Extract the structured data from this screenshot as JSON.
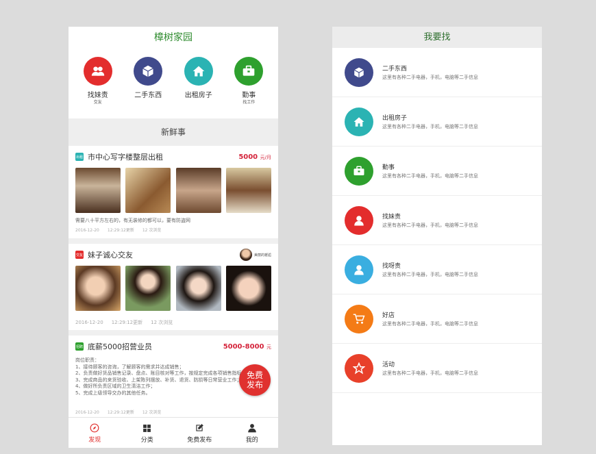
{
  "left": {
    "title": "樟树家园",
    "categories": [
      {
        "label": "找妹责",
        "sub": "交友",
        "icon": "people-icon",
        "color": "#e32d2d"
      },
      {
        "label": "二手东西",
        "sub": "",
        "icon": "box-icon",
        "color": "#404a8c"
      },
      {
        "label": "出租房子",
        "sub": "",
        "icon": "house-icon",
        "color": "#2bb3b3"
      },
      {
        "label": "勤事",
        "sub": "找工作",
        "icon": "briefcase-icon",
        "color": "#2ea02e"
      }
    ],
    "section_title": "新鲜事",
    "post1": {
      "tag": "出租",
      "tag_color": "#2bb3b3",
      "title": "市中心写字楼整层出租",
      "price": "5000",
      "price_unit": "元/月",
      "desc": "需要八十平方左右的，有无装修的都可以，要有防盗网",
      "date": "2016-12-20",
      "updated": "12:29:12更新",
      "views": "12 次浏览"
    },
    "post2": {
      "tag": "交友",
      "tag_color": "#e32d2d",
      "title": "妹子诚心交友",
      "user": "美丽的邂逅",
      "date": "2016-12-20",
      "updated": "12:29:12更新",
      "views": "12 次浏览"
    },
    "post3": {
      "tag": "招聘",
      "tag_color": "#2ea02e",
      "title": "底薪5000招营业员",
      "price": "5000-8000",
      "price_unit": "元",
      "body": [
        "岗位职责：",
        "1、接待顾客的咨询，了解顾客的需求并达成销售；",
        "2、负责做好货品销售记录、盘点、账目核对等工作，按规定完成各项销售指标；",
        "3、完成商品的来货验收、上架陈列摆放、补货、退货、防损等日常营业工作；",
        "4、做好所负责区域的卫生清洁工作；",
        "5、完成上级领导交办的其他任务。"
      ],
      "date": "2016-12-20",
      "updated": "12:29:12更新",
      "views": "12 次浏览"
    },
    "fab": "免费发布",
    "tabs": [
      {
        "label": "发现",
        "icon": "compass-icon"
      },
      {
        "label": "分类",
        "icon": "grid-icon"
      },
      {
        "label": "免费发布",
        "icon": "edit-icon"
      },
      {
        "label": "我的",
        "icon": "user-icon"
      }
    ]
  },
  "right": {
    "title": "我要找",
    "items": [
      {
        "name": "二手东西",
        "desc": "这里有各种二手电器，手机，电脑等二手信息",
        "icon": "box-icon",
        "color": "#404a8c"
      },
      {
        "name": "出租房子",
        "desc": "这里有各种二手电器，手机，电脑等二手信息",
        "icon": "house-icon",
        "color": "#2bb3b3"
      },
      {
        "name": "勤事",
        "desc": "这里有各种二手电器，手机，电脑等二手信息",
        "icon": "briefcase-icon",
        "color": "#2ea02e"
      },
      {
        "name": "找妹责",
        "desc": "这里有各种二手电器，手机，电脑等二手信息",
        "icon": "user-icon",
        "color": "#e32d2d"
      },
      {
        "name": "找呀责",
        "desc": "这里有各种二手电器，手机，电脑等二手信息",
        "icon": "user-icon",
        "color": "#3aaee0"
      },
      {
        "name": "好店",
        "desc": "这里有各种二手电器，手机，电脑等二手信息",
        "icon": "cart-icon",
        "color": "#f47b16"
      },
      {
        "name": "活动",
        "desc": "这里有各种二手电器，手机，电脑等二手信息",
        "icon": "star-icon",
        "color": "#e8402a"
      }
    ]
  }
}
